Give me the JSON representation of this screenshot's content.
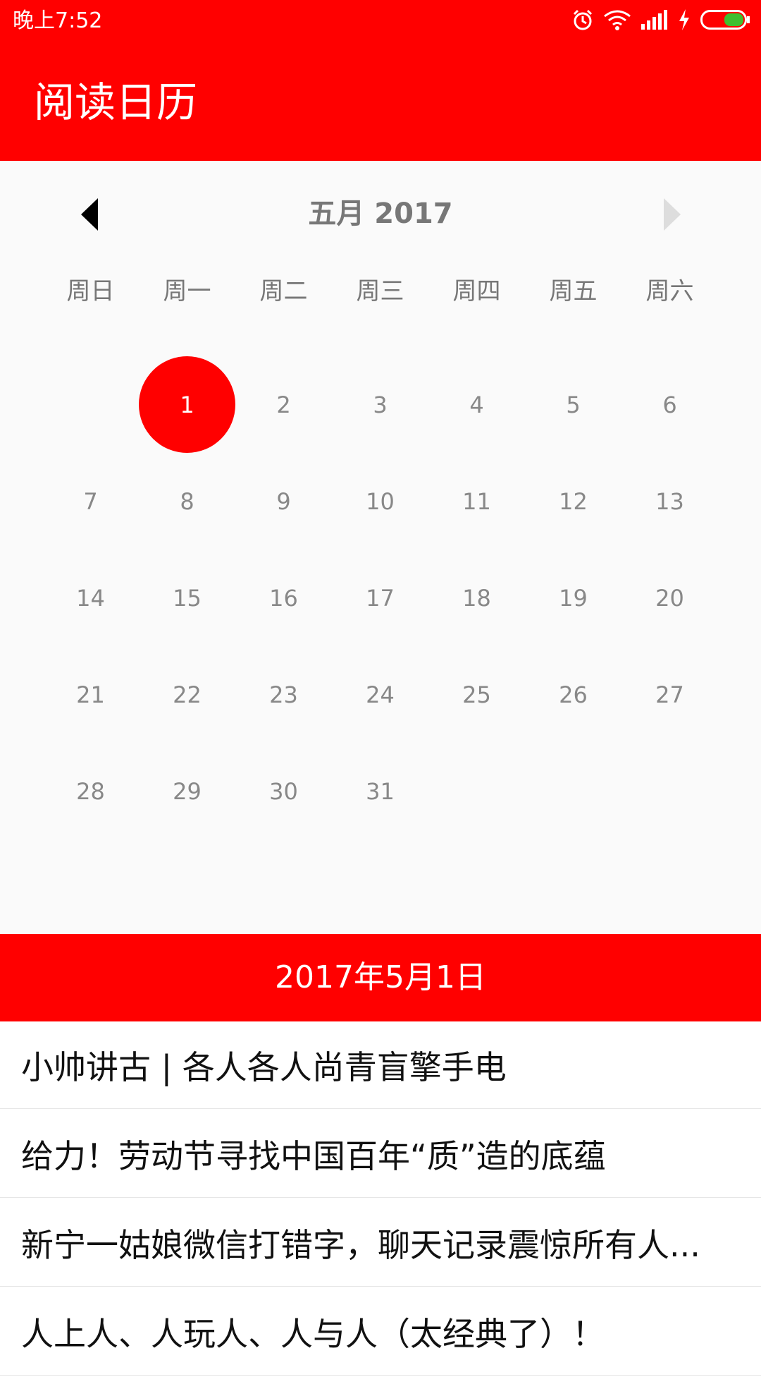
{
  "status_bar": {
    "time": "晚上7:52",
    "icons": [
      "alarm-icon",
      "wifi-icon",
      "signal-icon",
      "charging-icon",
      "battery-icon"
    ]
  },
  "app_bar": {
    "title": "阅读日历"
  },
  "calendar": {
    "month_title": "五月 2017",
    "prev_icon": "chevron-left-icon",
    "next_icon": "chevron-right-icon",
    "weekdays": [
      "周日",
      "周一",
      "周二",
      "周三",
      "周四",
      "周五",
      "周六"
    ],
    "days": [
      "",
      "1",
      "2",
      "3",
      "4",
      "5",
      "6",
      "7",
      "8",
      "9",
      "10",
      "11",
      "12",
      "13",
      "14",
      "15",
      "16",
      "17",
      "18",
      "19",
      "20",
      "21",
      "22",
      "23",
      "24",
      "25",
      "26",
      "27",
      "28",
      "29",
      "30",
      "31"
    ],
    "selected_day": "1"
  },
  "selected_date_header": "2017年5月1日",
  "articles": [
    {
      "title": "小帅讲古 | 各人各人尚青盲擎手电"
    },
    {
      "title": "给力！劳动节寻找中国百年“质”造的底蕴"
    },
    {
      "title": "新宁一姑娘微信打错字，聊天记录震惊所有人..."
    },
    {
      "title": "人上人、人玩人、人与人（太经典了）！"
    }
  ],
  "colors": {
    "accent": "#ff0000",
    "calendar_bg": "#fafafa",
    "muted_text": "#888888"
  }
}
